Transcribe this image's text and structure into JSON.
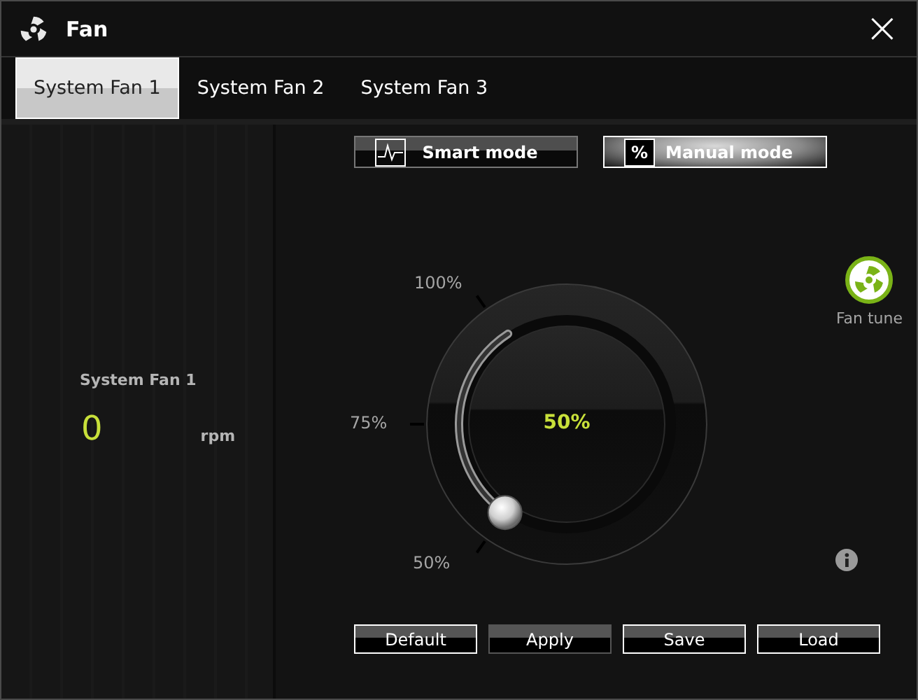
{
  "window": {
    "title": "Fan",
    "close": "×"
  },
  "tabs": [
    {
      "label": "System Fan 1",
      "selected": true
    },
    {
      "label": "System Fan 2",
      "selected": false
    },
    {
      "label": "System Fan 3",
      "selected": false
    }
  ],
  "sensor": {
    "name": "System Fan 1",
    "value": "0",
    "unit": "rpm"
  },
  "modes": [
    {
      "label": "Smart mode",
      "kind": "smart",
      "selected": false
    },
    {
      "label": "Manual mode",
      "kind": "manual",
      "icon_text": "%",
      "selected": true
    }
  ],
  "knob": {
    "value": "50%",
    "level": 0,
    "scale": [
      "100%",
      "75%",
      "50%"
    ]
  },
  "fan_tune": {
    "label": "Fan tune"
  },
  "buttons": [
    {
      "label": "Default",
      "disabled": false
    },
    {
      "label": "Apply",
      "disabled": true
    },
    {
      "label": "Save",
      "disabled": false
    },
    {
      "label": "Load",
      "disabled": false
    }
  ]
}
